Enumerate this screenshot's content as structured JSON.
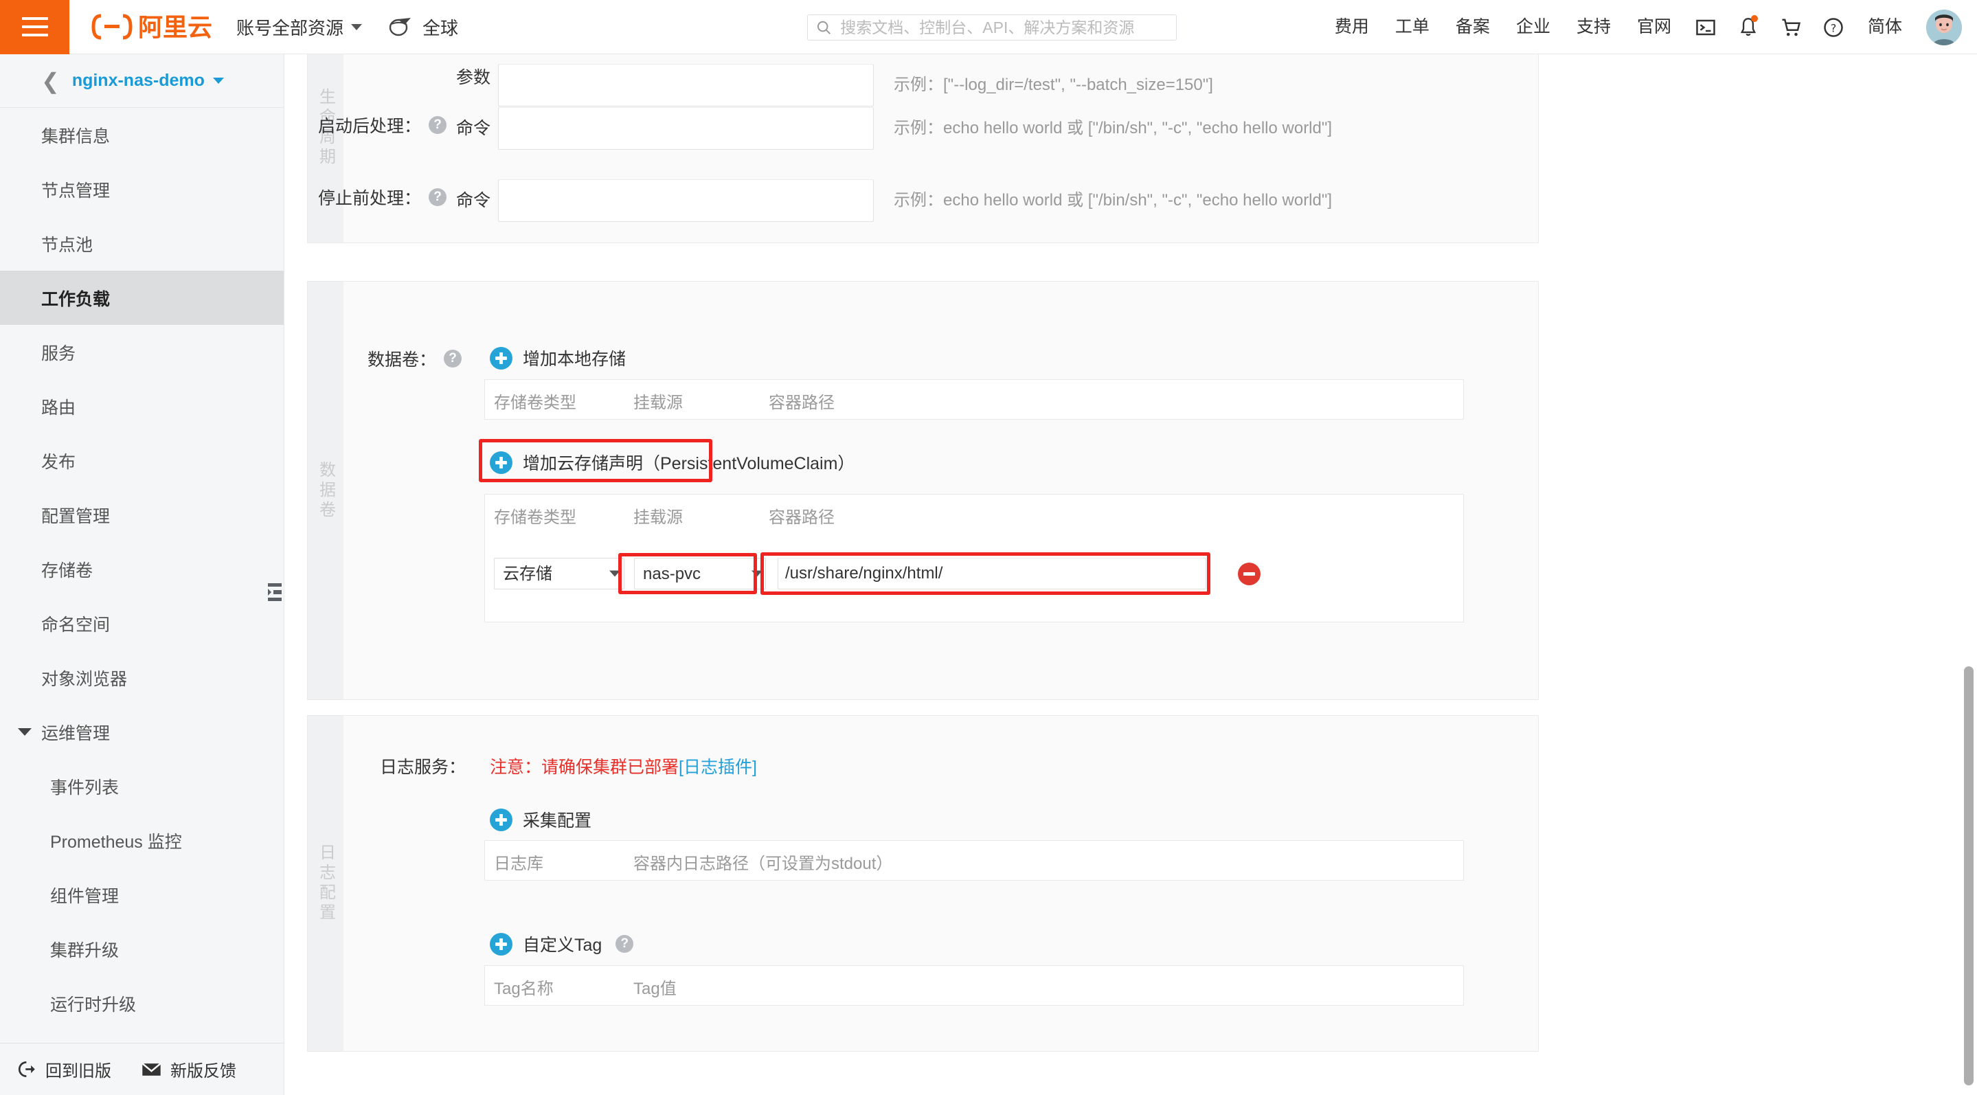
{
  "header": {
    "menu_icon": "hamburger-icon",
    "logo_text": "阿里云",
    "account_selector": "账号全部资源",
    "region_icon": "globe-plane-icon",
    "region": "全球",
    "search_placeholder": "搜索文档、控制台、API、解决方案和资源",
    "search_value": "",
    "nav_links": [
      "费用",
      "工单",
      "备案",
      "企业",
      "支持",
      "官网"
    ],
    "icons": [
      "terminal-icon",
      "bell-icon",
      "cart-icon",
      "help-icon"
    ],
    "language": "简体",
    "avatar": "user-avatar",
    "brand_orange": "#f4610f",
    "notification_dot": true
  },
  "sidebar": {
    "back_icon": "chevron-left-icon",
    "cluster_name": "nginx-nas-demo",
    "cluster_caret": "chevron-down-icon",
    "items": [
      {
        "label": "集群信息",
        "level": "top",
        "selected": false
      },
      {
        "label": "节点管理",
        "level": "top",
        "selected": false
      },
      {
        "label": "节点池",
        "level": "top",
        "selected": false
      },
      {
        "label": "工作负载",
        "level": "top",
        "selected": true
      },
      {
        "label": "服务",
        "level": "top",
        "selected": false
      },
      {
        "label": "路由",
        "level": "top",
        "selected": false
      },
      {
        "label": "发布",
        "level": "top",
        "selected": false
      },
      {
        "label": "配置管理",
        "level": "top",
        "selected": false
      },
      {
        "label": "存储卷",
        "level": "top",
        "selected": false
      },
      {
        "label": "命名空间",
        "level": "top",
        "selected": false
      },
      {
        "label": "对象浏览器",
        "level": "top",
        "selected": false
      },
      {
        "label": "运维管理",
        "level": "group",
        "selected": false
      },
      {
        "label": "事件列表",
        "level": "sub",
        "selected": false
      },
      {
        "label": "Prometheus 监控",
        "level": "sub",
        "selected": false
      },
      {
        "label": "组件管理",
        "level": "sub",
        "selected": false
      },
      {
        "label": "集群升级",
        "level": "sub",
        "selected": false
      },
      {
        "label": "运行时升级",
        "level": "sub",
        "selected": false
      }
    ],
    "collapse_handle": "sidebar-collapse-icon",
    "footer": {
      "old_version": "回到旧版",
      "old_version_icon": "exit-icon",
      "feedback": "新版反馈",
      "feedback_icon": "envelope-icon"
    }
  },
  "main": {
    "lifecycle_section": {
      "vtab_label": "生命周期",
      "rows": [
        {
          "label": "",
          "has_help": false,
          "inline_label": "参数",
          "value": "",
          "hint": "示例：[\"--log_dir=/test\", \"--batch_size=150\"]"
        },
        {
          "label": "启动后处理：",
          "has_help": true,
          "inline_label": "命令",
          "value": "",
          "hint": "示例：echo hello world 或 [\"/bin/sh\", \"-c\", \"echo hello world\"]"
        },
        {
          "label": "停止前处理：",
          "has_help": true,
          "inline_label": "命令",
          "value": "",
          "hint": "示例：echo hello world 或 [\"/bin/sh\", \"-c\", \"echo hello world\"]"
        }
      ]
    },
    "volume_section": {
      "vtab_label": "数据卷",
      "label": "数据卷：",
      "has_help": true,
      "local_storage_button": "增加本地存储",
      "local_table_headers": [
        "存储卷类型",
        "挂载源",
        "容器路径"
      ],
      "local_rows": [],
      "pvc_button": "增加云存储声明（PersistentVolumeClaim）",
      "pvc_button_highlighted": true,
      "pvc_table_headers": [
        "存储卷类型",
        "挂载源",
        "容器路径"
      ],
      "pvc_rows": [
        {
          "volume_type": "云存储",
          "volume_type_options": [
            "云存储"
          ],
          "mount_source": "nas-pvc",
          "mount_source_options": [
            "nas-pvc"
          ],
          "container_path": "/usr/share/nginx/html/",
          "mount_source_highlighted": true,
          "container_path_highlighted": true,
          "delete_icon": "minus-circle-icon"
        }
      ]
    },
    "log_section": {
      "vtab_label": "日志配置",
      "label": "日志服务：",
      "warning_text": "注意：请确保集群已部署",
      "warning_link": "[日志插件]",
      "collect_button": "采集配置",
      "collect_table_headers": [
        "日志库",
        "容器内日志路径（可设置为stdout）"
      ],
      "custom_tag_button": "自定义Tag",
      "custom_tag_has_help": true,
      "tag_table_headers": [
        "Tag名称",
        "Tag值"
      ]
    }
  },
  "colors": {
    "brand": "#f4610f",
    "accent_blue": "#26a4d8",
    "link_blue": "#1a9bd7",
    "danger_red": "#e8302a",
    "highlight_red": "#ef2420"
  },
  "scrollbar": {
    "name": "vertical-scrollbar",
    "visible": true
  }
}
